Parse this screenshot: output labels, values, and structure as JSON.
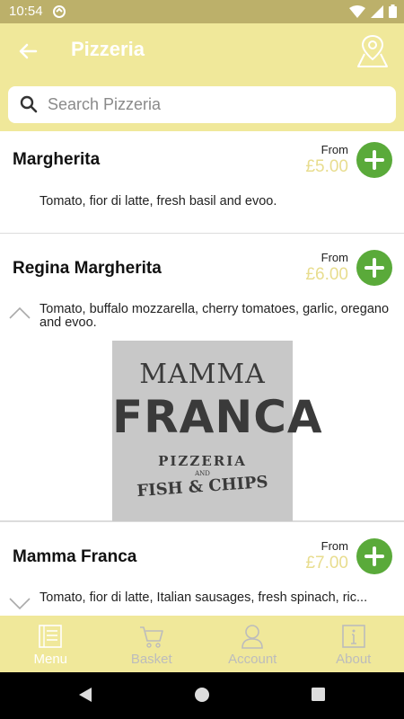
{
  "status": {
    "time": "10:54"
  },
  "header": {
    "title": "Pizzeria"
  },
  "search": {
    "placeholder": "Search Pizzeria",
    "value": ""
  },
  "items": [
    {
      "name": "Margherita",
      "from": "From",
      "price": "£5.00",
      "description": "Tomato, fior di latte, fresh basil and evoo."
    },
    {
      "name": "Regina Margherita",
      "from": "From",
      "price": "£6.00",
      "description": "Tomato, buffalo mozzarella, cherry tomatoes, garlic, oregano and evoo."
    },
    {
      "name": "Mamma Franca",
      "from": "From",
      "price": "£7.00",
      "description": "Tomato, fior di latte, Italian sausages, fresh spinach, ric..."
    }
  ],
  "logo": {
    "line1": "MAMMA",
    "line2": "FRANCA",
    "line3": "PIZZERIA",
    "line4": "AND",
    "line5": "FISH & CHIPS"
  },
  "nav": [
    {
      "label": "Menu",
      "icon": "menu-icon",
      "active": true
    },
    {
      "label": "Basket",
      "icon": "cart-icon",
      "active": false
    },
    {
      "label": "Account",
      "icon": "user-icon",
      "active": false
    },
    {
      "label": "About",
      "icon": "info-icon",
      "active": false
    }
  ],
  "colors": {
    "accent": "#f0e89a",
    "status_bar": "#bcb06a",
    "add_button": "#5aaa3a",
    "price": "#e8dd8f"
  }
}
